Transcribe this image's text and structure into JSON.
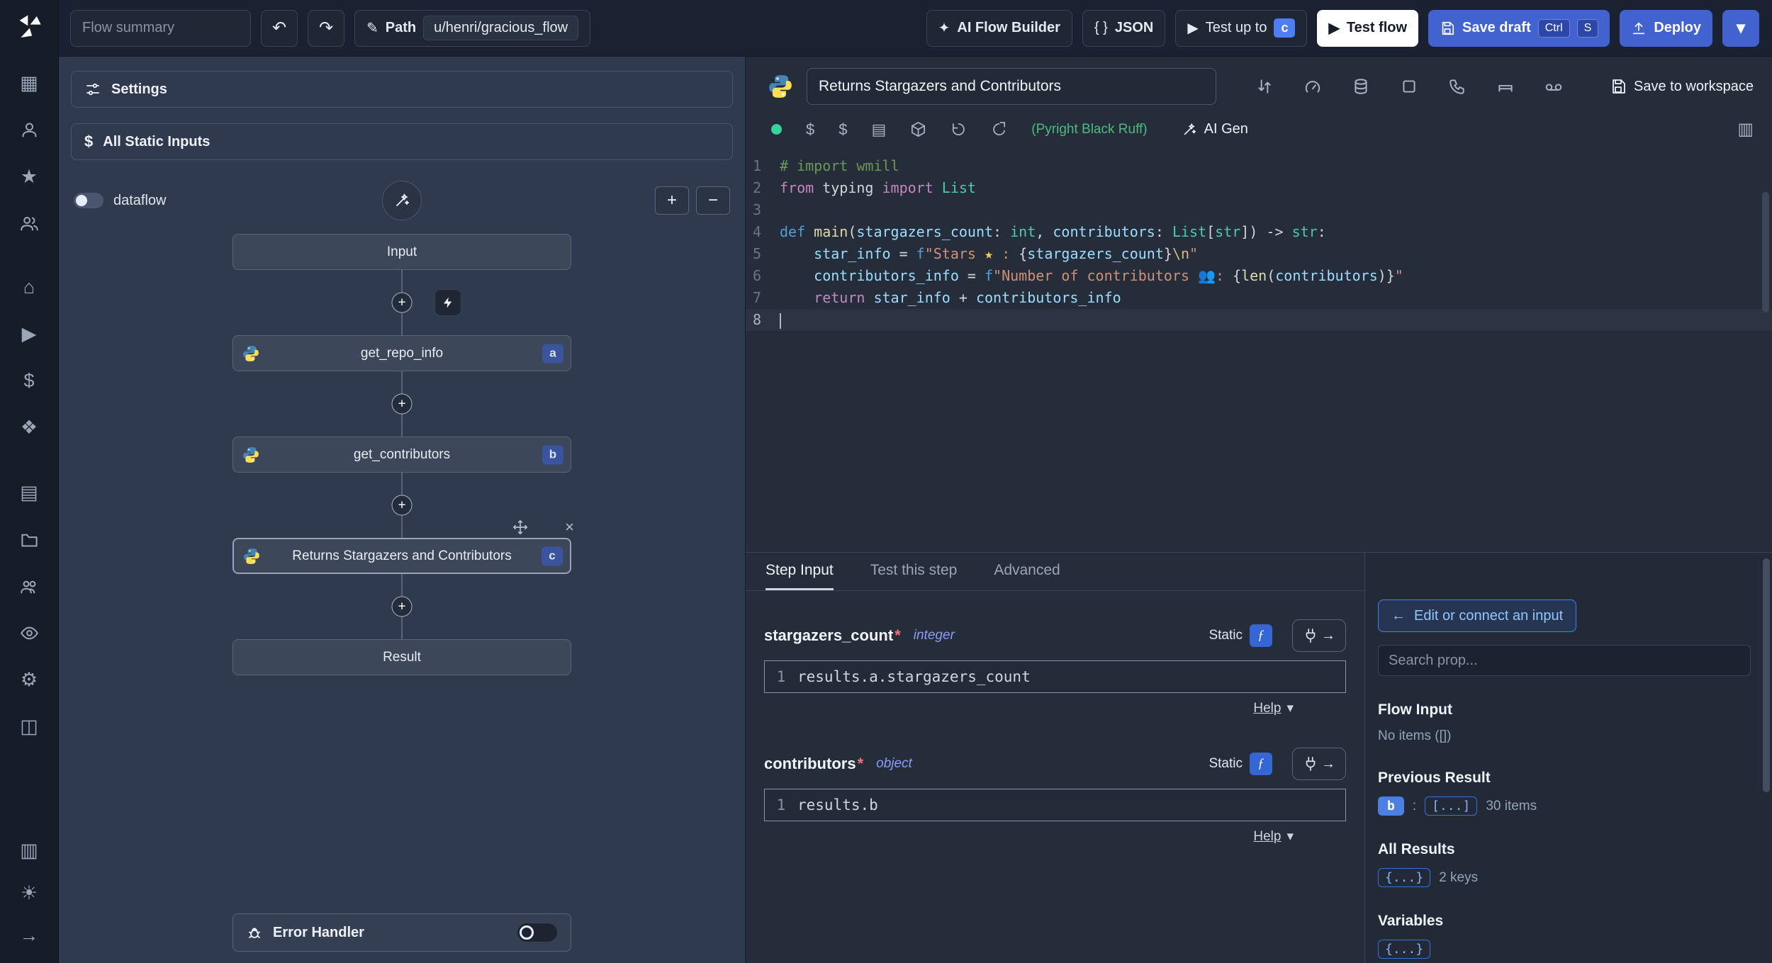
{
  "icons": {
    "undo": "↶",
    "redo": "↷",
    "pencil": "✎",
    "ai": "✦",
    "json": "{ }",
    "play": "▶",
    "chevron": "▾",
    "plus": "+",
    "minus": "−",
    "close": "×",
    "gear": "⚙",
    "home": "⌂",
    "star": "★",
    "sun": "☀",
    "arrow_right": "→",
    "arrow_left": "←",
    "dollar": "$",
    "grid": "▦",
    "box": "▤",
    "columns": "▥",
    "layers": "◫",
    "diamond": "❖",
    "book": "▥",
    "colon": ":"
  },
  "sidebar": {
    "icon_names": [
      "windmill-logo",
      "calendar",
      "user",
      "star",
      "users",
      "home",
      "play",
      "dollar",
      "puzzle",
      "box",
      "folder",
      "user-group",
      "eye",
      "gear",
      "layers",
      "columns",
      "theme",
      "expand"
    ]
  },
  "topbar": {
    "flow_summary_placeholder": "Flow summary",
    "path_label": "Path",
    "path_value": "u/henri/gracious_flow",
    "ai_flow_builder": "AI Flow Builder",
    "json_label": "JSON",
    "test_up_to": "Test up to",
    "test_up_to_badge": "c",
    "test_flow": "Test flow",
    "save_draft": "Save draft",
    "kbd": [
      "Ctrl",
      "S"
    ],
    "deploy": "Deploy"
  },
  "flow": {
    "settings": "Settings",
    "all_static_inputs": "All Static Inputs",
    "dataflow_label": "dataflow",
    "nodes": {
      "input": "Input",
      "a": {
        "label": "get_repo_info",
        "badge": "a"
      },
      "b": {
        "label": "get_contributors",
        "badge": "b"
      },
      "c": {
        "label": "Returns Stargazers and Contributors",
        "badge": "c"
      },
      "result": "Result"
    },
    "error_handler": "Error Handler"
  },
  "editor": {
    "title": "Returns Stargazers and Contributors",
    "save_to_workspace": "Save to workspace",
    "header_icon_names": [
      "swap",
      "gauge",
      "database",
      "square",
      "phone",
      "bench",
      "voicemail"
    ],
    "toolbar_icon_names": [
      "status-dot",
      "dollar",
      "dollar-alt",
      "package",
      "package-alt",
      "undo",
      "reload",
      "library"
    ],
    "assistants": "(Pyright Black Ruff)",
    "ai_gen": "AI Gen",
    "code": {
      "lines": [
        {
          "n": 1,
          "tokens": [
            {
              "t": "# import wmill",
              "c": "cm"
            }
          ]
        },
        {
          "n": 2,
          "tokens": [
            {
              "t": "from",
              "c": "kw"
            },
            {
              "t": " typing "
            },
            {
              "t": "import",
              "c": "kw"
            },
            {
              "t": " List",
              "c": "ty"
            }
          ]
        },
        {
          "n": 3,
          "tokens": []
        },
        {
          "n": 4,
          "tokens": [
            {
              "t": "def",
              "c": "kw2"
            },
            {
              "t": " "
            },
            {
              "t": "main",
              "c": "fn"
            },
            {
              "t": "("
            },
            {
              "t": "stargazers_count",
              "c": "vr"
            },
            {
              "t": ": "
            },
            {
              "t": "int",
              "c": "ty"
            },
            {
              "t": ", "
            },
            {
              "t": "contributors",
              "c": "vr"
            },
            {
              "t": ": "
            },
            {
              "t": "List",
              "c": "ty"
            },
            {
              "t": "["
            },
            {
              "t": "str",
              "c": "ty"
            },
            {
              "t": "]"
            },
            {
              "t": ") -> "
            },
            {
              "t": "str",
              "c": "ty"
            },
            {
              "t": ":"
            }
          ]
        },
        {
          "n": 5,
          "tokens": [
            {
              "t": "    "
            },
            {
              "t": "star_info",
              "c": "vr"
            },
            {
              "t": " = "
            },
            {
              "t": "f",
              "c": "kw2"
            },
            {
              "t": "\"Stars ",
              "c": "st"
            },
            {
              "t": "★",
              "c": "em"
            },
            {
              "t": " : ",
              "c": "st"
            },
            {
              "t": "{"
            },
            {
              "t": "stargazers_count",
              "c": "vr"
            },
            {
              "t": "}"
            },
            {
              "t": "\\n",
              "c": "es"
            },
            {
              "t": "\"",
              "c": "st"
            }
          ]
        },
        {
          "n": 6,
          "tokens": [
            {
              "t": "    "
            },
            {
              "t": "contributors_info",
              "c": "vr"
            },
            {
              "t": " = "
            },
            {
              "t": "f",
              "c": "kw2"
            },
            {
              "t": "\"Number of contributors ",
              "c": "st"
            },
            {
              "t": "👥",
              "c": "em"
            },
            {
              "t": ": ",
              "c": "st"
            },
            {
              "t": "{"
            },
            {
              "t": "len",
              "c": "fn"
            },
            {
              "t": "("
            },
            {
              "t": "contributors",
              "c": "vr"
            },
            {
              "t": ")"
            },
            {
              "t": "}"
            },
            {
              "t": "\"",
              "c": "st"
            }
          ]
        },
        {
          "n": 7,
          "tokens": [
            {
              "t": "    "
            },
            {
              "t": "return",
              "c": "kw"
            },
            {
              "t": " "
            },
            {
              "t": "star_info",
              "c": "vr"
            },
            {
              "t": " + "
            },
            {
              "t": "contributors_info",
              "c": "vr"
            }
          ]
        },
        {
          "n": 8,
          "active": true,
          "tokens": []
        }
      ]
    }
  },
  "step_panel": {
    "tabs": [
      {
        "label": "Step Input"
      },
      {
        "label": "Test this step"
      },
      {
        "label": "Advanced"
      }
    ],
    "fields": [
      {
        "name": "stargazers_count",
        "required": "*",
        "type": "integer",
        "mode": "Static",
        "line_no": "1",
        "expr": "results.a.stargazers_count",
        "help": "Help"
      },
      {
        "name": "contributors",
        "required": "*",
        "type": "object",
        "mode": "Static",
        "line_no": "1",
        "expr": "results.b",
        "help": "Help"
      }
    ]
  },
  "prop_panel": {
    "back_label": "Edit or connect an input",
    "search_placeholder": "Search prop...",
    "flow_input_title": "Flow Input",
    "flow_input_empty": "No items ([])",
    "previous_result_title": "Previous Result",
    "prev_badge": "b",
    "prev_collapsed": "[...]",
    "prev_count": "30 items",
    "all_results_title": "All Results",
    "all_results_collapsed": "{...}",
    "all_results_count": "2 keys",
    "variables_title": "Variables",
    "variables_collapsed": "{...}"
  },
  "colors": {
    "accent_blue": "#3b82f6",
    "button_blue": "#4263cf",
    "status_green": "#34d399",
    "panel_bg": "#2f3a4e",
    "editor_bg": "#262d3a"
  }
}
